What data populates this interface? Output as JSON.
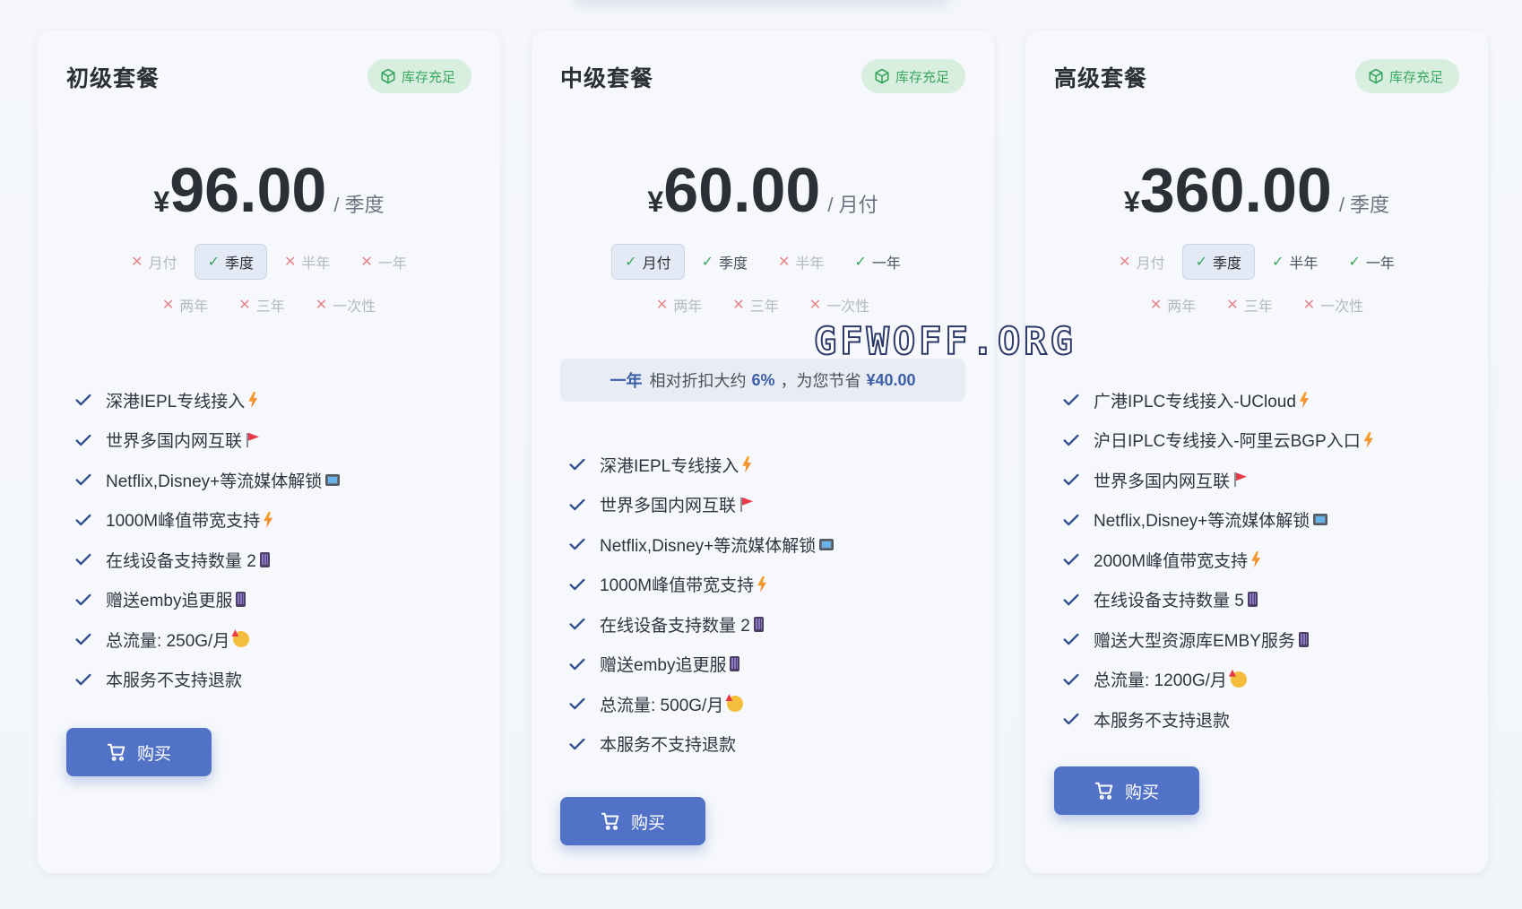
{
  "watermark": "GFWOFF.ORG",
  "stock_label": "库存充足",
  "buy_label": "购买",
  "colors": {
    "accent": "#5272c8",
    "stock_green": "#3aa761",
    "unavailable_red": "#e6878a"
  },
  "plans": [
    {
      "title": "初级套餐",
      "currency": "¥",
      "price": "96.00",
      "period": "/ 季度",
      "cycles": [
        {
          "label": "月付",
          "available": false,
          "selected": false
        },
        {
          "label": "季度",
          "available": true,
          "selected": true
        },
        {
          "label": "半年",
          "available": false,
          "selected": false
        },
        {
          "label": "一年",
          "available": false,
          "selected": false
        },
        {
          "label": "两年",
          "available": false,
          "selected": false
        },
        {
          "label": "三年",
          "available": false,
          "selected": false
        },
        {
          "label": "一次性",
          "available": false,
          "selected": false
        }
      ],
      "features": [
        {
          "text": "深港IEPL专线接入",
          "icon": "bolt-icon"
        },
        {
          "text": "世界多国内网互联",
          "icon": "flag-icon"
        },
        {
          "text": "Netflix,Disney+等流媒体解锁",
          "icon": "tv-icon"
        },
        {
          "text": "1000M峰值带宽支持",
          "icon": "bolt-icon"
        },
        {
          "text": "在线设备支持数量 2",
          "icon": "phone-icon"
        },
        {
          "text": "赠送emby追更服",
          "icon": "phone-icon"
        },
        {
          "text": "总流量: 250G/月",
          "icon": "party-icon"
        },
        {
          "text": "本服务不支持退款",
          "icon": ""
        }
      ]
    },
    {
      "title": "中级套餐",
      "currency": "¥",
      "price": "60.00",
      "period": "/ 月付",
      "cycles": [
        {
          "label": "月付",
          "available": true,
          "selected": true
        },
        {
          "label": "季度",
          "available": true,
          "selected": false
        },
        {
          "label": "半年",
          "available": false,
          "selected": false
        },
        {
          "label": "一年",
          "available": true,
          "selected": false
        },
        {
          "label": "两年",
          "available": false,
          "selected": false
        },
        {
          "label": "三年",
          "available": false,
          "selected": false
        },
        {
          "label": "一次性",
          "available": false,
          "selected": false
        }
      ],
      "discount": {
        "cycle": "一年",
        "text_a": "相对折扣大约",
        "percent": "6%",
        "text_b": "，为您节省",
        "saving": "¥40.00"
      },
      "features": [
        {
          "text": "深港IEPL专线接入",
          "icon": "bolt-icon"
        },
        {
          "text": "世界多国内网互联",
          "icon": "flag-icon"
        },
        {
          "text": "Netflix,Disney+等流媒体解锁",
          "icon": "tv-icon"
        },
        {
          "text": "1000M峰值带宽支持",
          "icon": "bolt-icon"
        },
        {
          "text": "在线设备支持数量 2",
          "icon": "phone-icon"
        },
        {
          "text": "赠送emby追更服",
          "icon": "phone-icon"
        },
        {
          "text": "总流量: 500G/月",
          "icon": "party-icon"
        },
        {
          "text": "本服务不支持退款",
          "icon": ""
        }
      ]
    },
    {
      "title": "高级套餐",
      "currency": "¥",
      "price": "360.00",
      "period": "/ 季度",
      "cycles": [
        {
          "label": "月付",
          "available": false,
          "selected": false
        },
        {
          "label": "季度",
          "available": true,
          "selected": true
        },
        {
          "label": "半年",
          "available": true,
          "selected": false
        },
        {
          "label": "一年",
          "available": true,
          "selected": false
        },
        {
          "label": "两年",
          "available": false,
          "selected": false
        },
        {
          "label": "三年",
          "available": false,
          "selected": false
        },
        {
          "label": "一次性",
          "available": false,
          "selected": false
        }
      ],
      "features": [
        {
          "text": "广港IPLC专线接入-UCloud",
          "icon": "bolt-icon"
        },
        {
          "text": "沪日IPLC专线接入-阿里云BGP入口",
          "icon": "bolt-icon"
        },
        {
          "text": "世界多国内网互联",
          "icon": "flag-icon"
        },
        {
          "text": "Netflix,Disney+等流媒体解锁",
          "icon": "tv-icon"
        },
        {
          "text": "2000M峰值带宽支持",
          "icon": "bolt-icon"
        },
        {
          "text": "在线设备支持数量 5",
          "icon": "phone-icon"
        },
        {
          "text": "赠送大型资源库EMBY服务",
          "icon": "phone-icon"
        },
        {
          "text": "总流量: 1200G/月",
          "icon": "party-icon"
        },
        {
          "text": "本服务不支持退款",
          "icon": ""
        }
      ]
    }
  ]
}
